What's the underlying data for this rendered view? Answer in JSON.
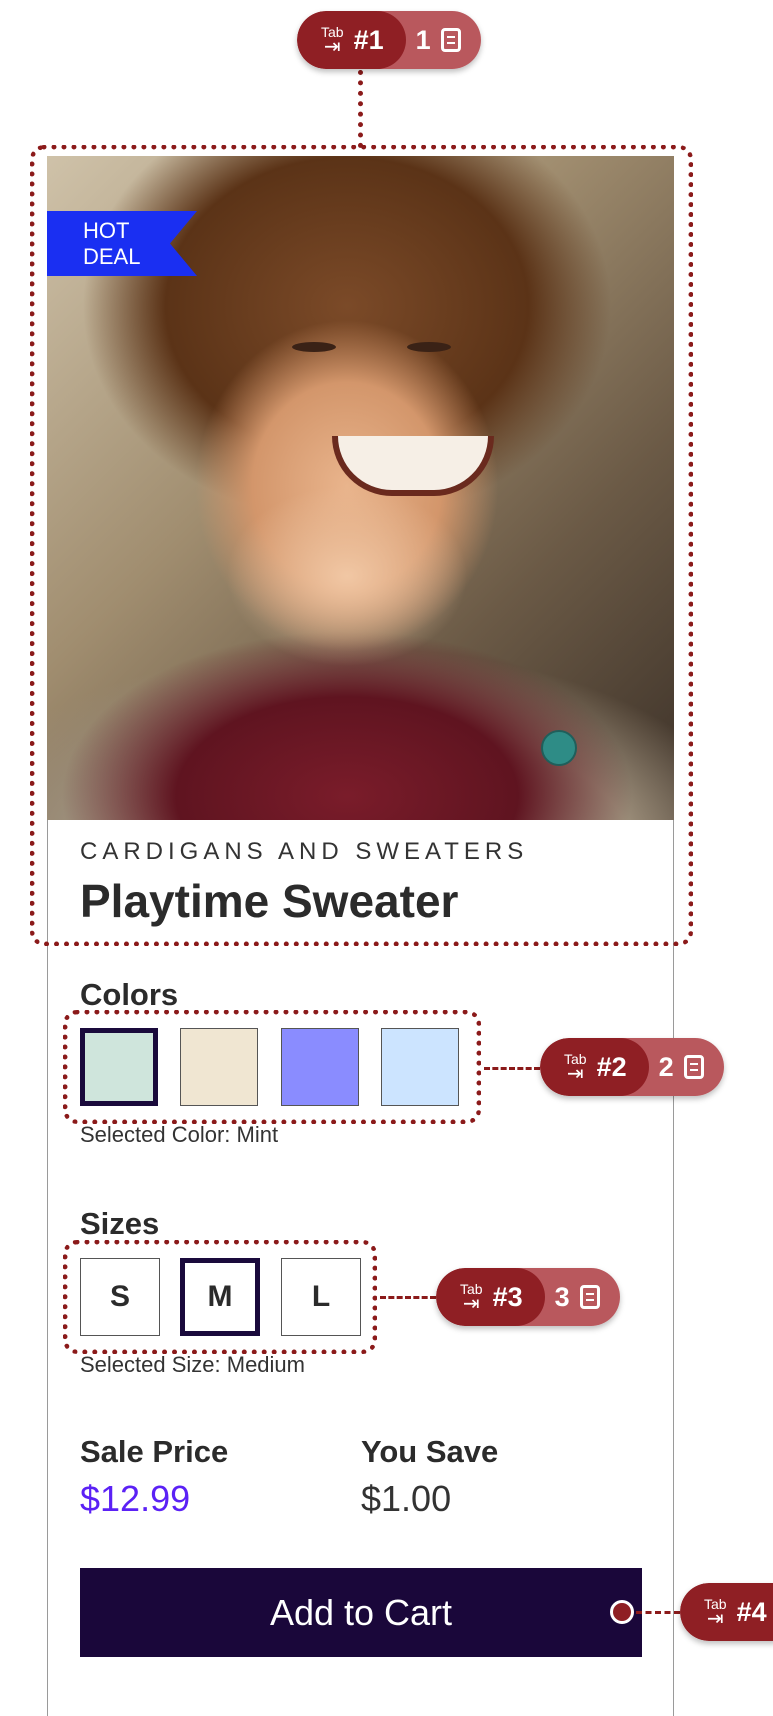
{
  "product": {
    "badge_line1": "HOT",
    "badge_line2": "DEAL",
    "category": "CARDIGANS AND SWEATERS",
    "title": "Playtime Sweater"
  },
  "colors": {
    "label": "Colors",
    "swatches": [
      {
        "name": "Mint",
        "hex": "#cfe5dc",
        "selected": true
      },
      {
        "name": "Cream",
        "hex": "#f0e6d2",
        "selected": false
      },
      {
        "name": "Periwinkle",
        "hex": "#8a8cff",
        "selected": false
      },
      {
        "name": "Light Blue",
        "hex": "#cce4ff",
        "selected": false
      }
    ],
    "selected_text": "Selected Color: Mint"
  },
  "sizes": {
    "label": "Sizes",
    "options": [
      "S",
      "M",
      "L"
    ],
    "selected_text": "Selected Size: Medium"
  },
  "pricing": {
    "sale_label": "Sale Price",
    "sale_value": "$12.99",
    "save_label": "You Save",
    "save_value": "$1.00"
  },
  "cart": {
    "label": "Add to Cart"
  },
  "annotations": [
    {
      "tab_key": "Tab",
      "order": "#1",
      "count": "1"
    },
    {
      "tab_key": "Tab",
      "order": "#2",
      "count": "2"
    },
    {
      "tab_key": "Tab",
      "order": "#3",
      "count": "3"
    },
    {
      "tab_key": "Tab",
      "order": "#4"
    }
  ],
  "colors_theme": {
    "accent": "#1a073a",
    "sale_price": "#5b21f5",
    "badge": "#1a2ff2",
    "annotation": "#8f1f24"
  }
}
